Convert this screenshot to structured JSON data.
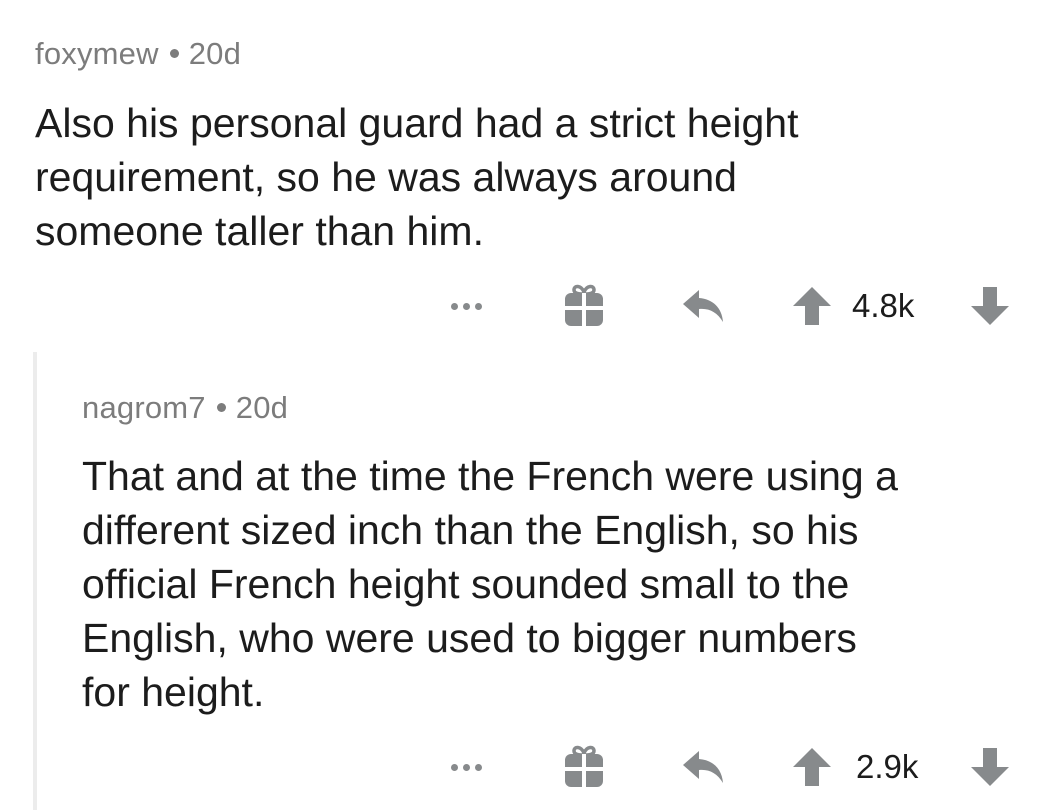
{
  "comments": [
    {
      "author": "foxymew",
      "age": "20d",
      "text": "Also his personal guard had a strict height\nrequirement, so he was always around\nsomeone taller than him.",
      "score": "4.8k"
    },
    {
      "author": "nagrom7",
      "age": "20d",
      "text": "That and at the time the French were using a\ndifferent sized inch than the English, so his\nofficial French height sounded small to the\nEnglish, who were used to bigger numbers\nfor height.",
      "score": "2.9k"
    }
  ],
  "icons": {
    "more": "more-options-icon",
    "gift": "gift-icon",
    "reply": "reply-icon",
    "upvote": "upvote-arrow-icon",
    "downvote": "downvote-arrow-icon"
  },
  "colors": {
    "icon_gray": "#878a8c",
    "meta_gray": "#7c7c7c",
    "text": "#1c1c1c",
    "thread_line": "#ececec"
  }
}
